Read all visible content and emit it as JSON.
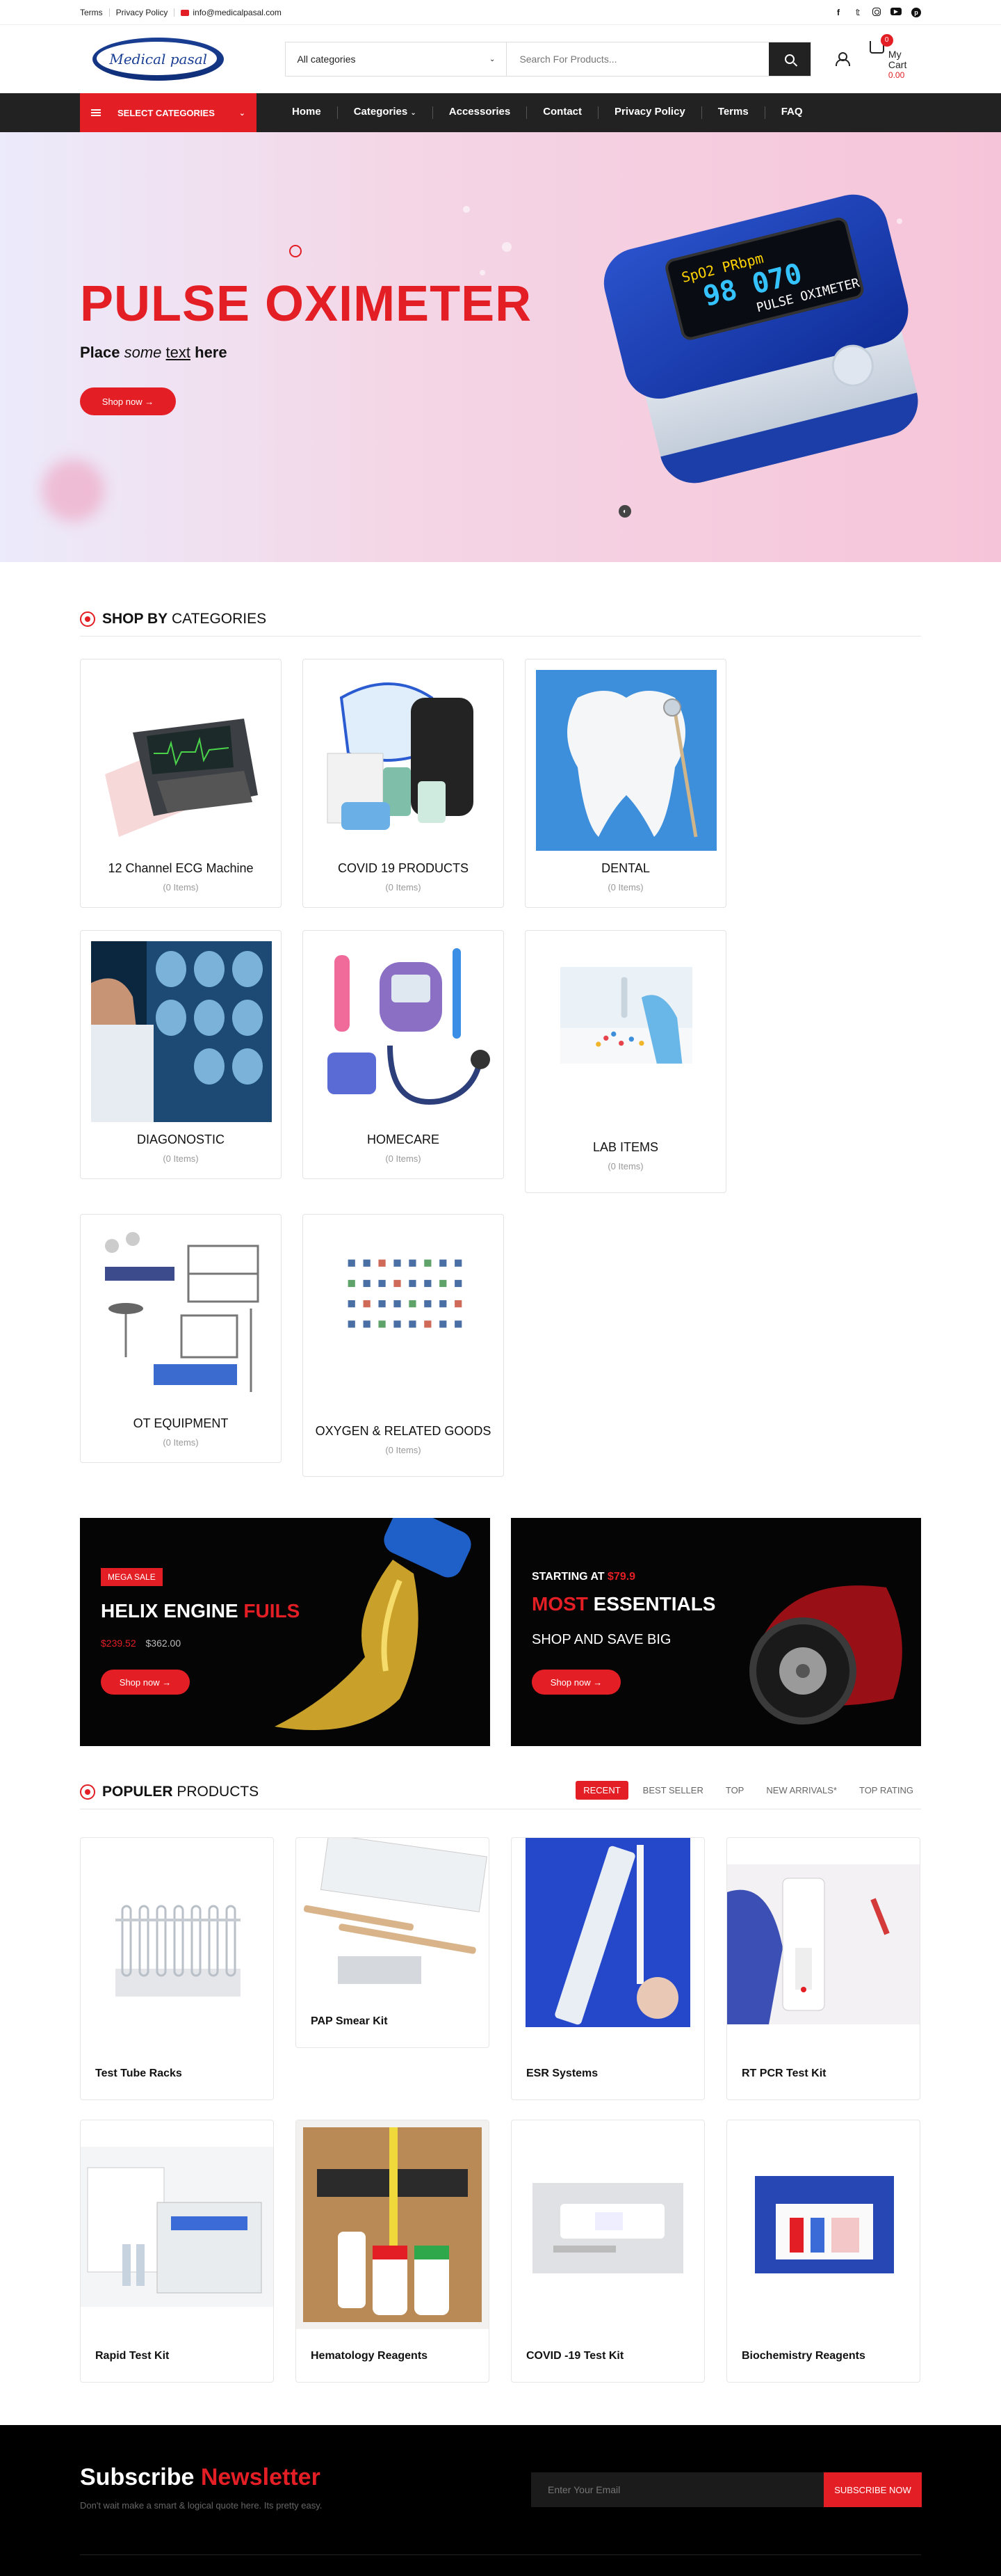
{
  "topbar": {
    "links": [
      "Terms",
      "Privacy Policy"
    ],
    "email": "info@medicalpasal.com",
    "socials": [
      "facebook-icon",
      "twitter-icon",
      "instagram-icon",
      "youtube-icon",
      "pinterest-icon"
    ]
  },
  "header": {
    "logo_text": "Medical pasal",
    "category_select": "All categories",
    "search_placeholder": "Search For Products...",
    "cart_count": "0",
    "cart_label": "My Cart",
    "cart_total": "0.00"
  },
  "nav": {
    "select_categories": "SELECT CATEGORIES",
    "items": [
      "Home",
      "Categories",
      "Accessories",
      "Contact",
      "Privacy Policy",
      "Terms",
      "FAQ"
    ]
  },
  "hero": {
    "title": "PULSE OXIMETER",
    "subtitle_part1": "Place ",
    "subtitle_some": "some",
    "subtitle_text": "text",
    "subtitle_here": "here",
    "cta": "Shop now →",
    "device_reading_top": "SpO2  PRbpm",
    "device_reading_main": "98 070",
    "device_label": "PULSE OXIMETER"
  },
  "categories": {
    "heading_bold": "SHOP BY",
    "heading_rest": " CATEGORIES",
    "items": [
      {
        "name": "12 Channel ECG Machine",
        "count": "(0 Items)"
      },
      {
        "name": "COVID 19 PRODUCTS",
        "count": "(0 Items)"
      },
      {
        "name": "DENTAL",
        "count": "(0 Items)"
      },
      {
        "name": "DIAGONOSTIC",
        "count": "(0 Items)"
      },
      {
        "name": "HOMECARE",
        "count": "(0 Items)"
      },
      {
        "name": "LAB ITEMS",
        "count": "(0 Items)"
      },
      {
        "name": "OT EQUIPMENT",
        "count": "(0 Items)"
      },
      {
        "name": "OXYGEN & RELATED GOODS",
        "count": "(0 Items)"
      }
    ]
  },
  "banners": {
    "left": {
      "tag": "MEGA SALE",
      "title_white": "HELIX ENGINE ",
      "title_red": "FUILS",
      "price_new": "$239.52",
      "price_old": "$362.00",
      "cta": "Shop now →"
    },
    "right": {
      "starting_at": "STARTING AT ",
      "starting_price": "$79.9",
      "title_red": "MOST",
      "title_white": " ESSENTIALS",
      "subtitle": "SHOP AND SAVE BIG",
      "cta": "Shop now →"
    }
  },
  "products": {
    "heading_bold": "POPULER",
    "heading_rest": " PRODUCTS",
    "tabs": [
      "RECENT",
      "BEST SELLER",
      "TOP",
      "NEW ARRIVALS*",
      "TOP RATING"
    ],
    "items": [
      {
        "name": "Test Tube Racks"
      },
      {
        "name": "PAP Smear Kit"
      },
      {
        "name": "ESR Systems"
      },
      {
        "name": "RT PCR Test Kit"
      },
      {
        "name": "Rapid Test Kit"
      },
      {
        "name": "Hematology Reagents"
      },
      {
        "name": "COVID -19 Test Kit"
      },
      {
        "name": "Biochemistry Reagents"
      }
    ]
  },
  "newsletter": {
    "title_white": "Subscribe ",
    "title_red": "Newsletter",
    "subtitle": "Don't wait make a smart & logical quote here. Its pretty easy.",
    "placeholder": "Enter Your Email",
    "button": "SUBSCRIBE NOW"
  },
  "colors": {
    "accent": "#e31e24",
    "dark": "#222222",
    "black": "#000000"
  }
}
